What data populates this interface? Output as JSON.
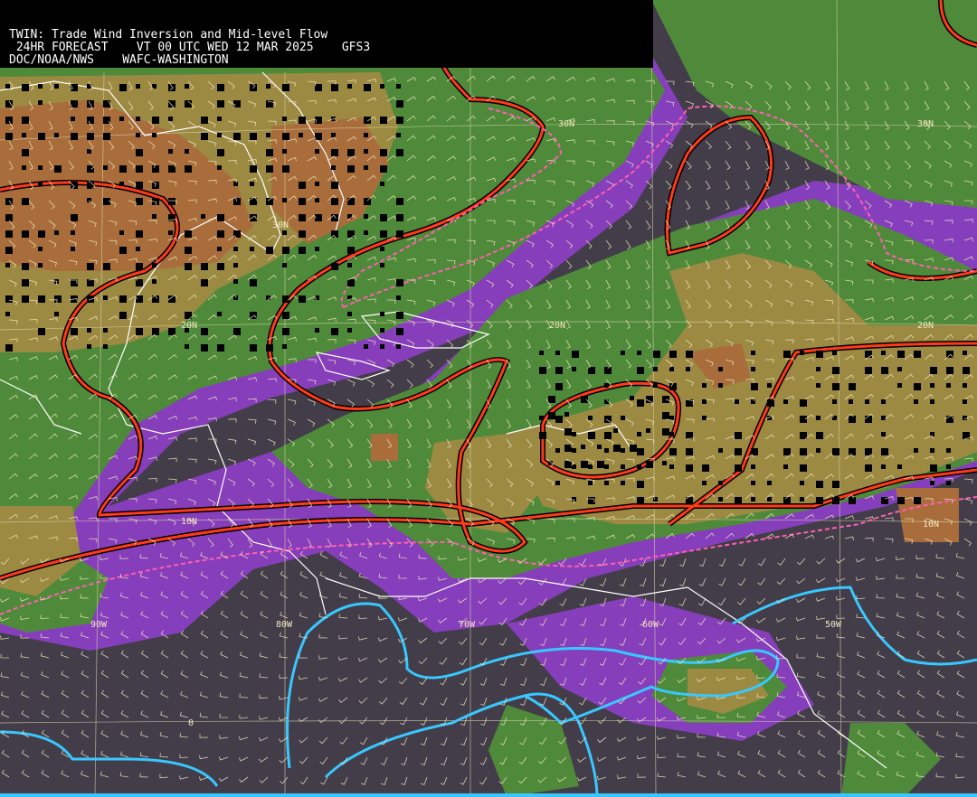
{
  "header": {
    "line1": "TWIN: Trade Wind Inversion and Mid-level Flow",
    "line2": " 24HR FORECAST    VT 00 UTC WED 12 MAR 2025    GFS3",
    "line3": "DOC/NOAA/NWS    WAFC-WASHINGTON"
  },
  "grid_labels": {
    "lat": [
      "30N",
      "20N",
      "10N",
      "0",
      "20N",
      "30N",
      "20N",
      "10N",
      "30N"
    ],
    "lon": [
      "90W",
      "80W",
      "70W",
      "60W",
      "50W"
    ]
  },
  "colors": {
    "background_dark": "#433d4a",
    "purple_band": "#8a3fc2",
    "green_zone": "#4f8a3a",
    "olive_zone": "#9c8a43",
    "brown_zone": "#a86d3b",
    "inversion_contour": "#ff3a1a",
    "dashed_contour": "#ff5fb0",
    "cyan_contour": "#38c8ff",
    "coastline": "#ffffff",
    "gridline": "#d8d0a8"
  }
}
